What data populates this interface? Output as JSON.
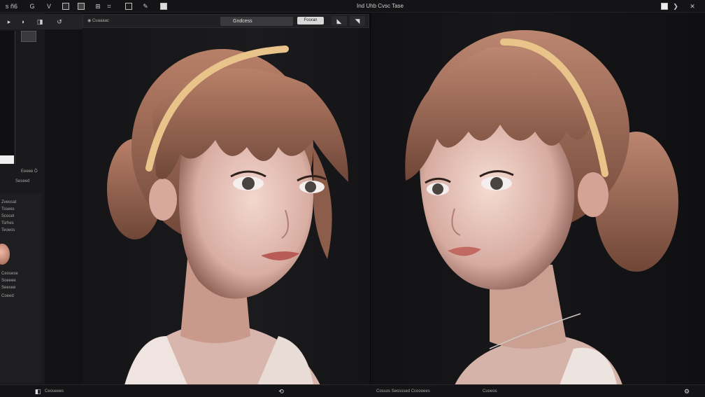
{
  "topbar": {
    "items": [
      {
        "label": "s"
      },
      {
        "label": "ñ6"
      },
      {
        "label": "G"
      },
      {
        "label": "V"
      },
      {
        "label": "✎"
      }
    ],
    "title": "Ind Uhb Cvsc Tase"
  },
  "subbar": {
    "field_label": "Cuaaaac",
    "document_name": "Gndcess",
    "badge": "Fooran"
  },
  "left_panel": {
    "label_a": "Eeeee Ö",
    "label_b": "Seseed",
    "labels": [
      "Zveosat",
      "Tssees",
      "Scocet",
      "Tsrhes",
      "Teoeos",
      "Ceosese",
      "Soeeee",
      "Seesee",
      "Coeed"
    ]
  },
  "statusbar": {
    "left_text": "Ceoseees",
    "middle_text": "Cossos Seosssed Ccoooees",
    "right_text": "Cuoeos"
  },
  "colors": {
    "background": "#0b0b0d",
    "panel": "#1a1a1c",
    "headband": "#e8c48a",
    "hair": "#a36b52"
  },
  "icons": [
    "menu-icon",
    "gear-icon",
    "chevron-right-icon",
    "close-icon",
    "brush-icon",
    "layers-icon"
  ]
}
